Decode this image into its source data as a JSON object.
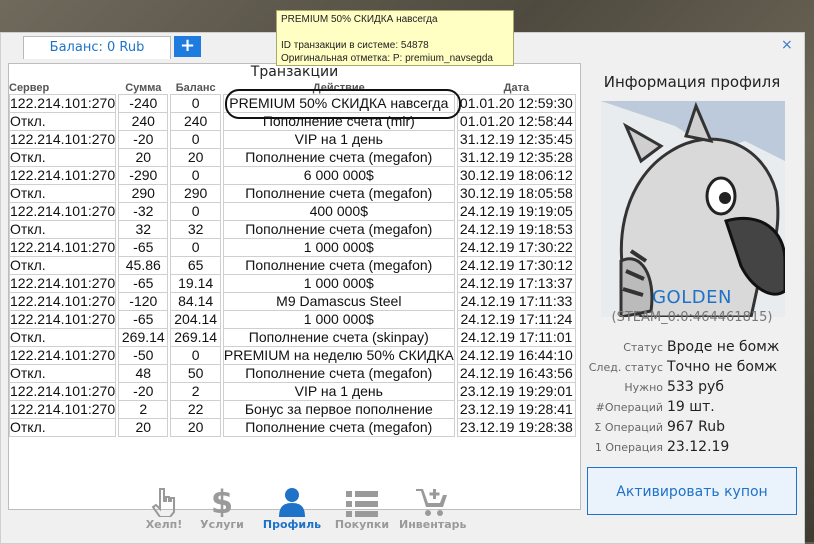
{
  "tabs": {
    "balance_label": "Баланс: 0 Rub",
    "add_label": "+"
  },
  "close_label": "×",
  "tooltip": {
    "line1": "PREMIUM 50% СКИДКА навсегда",
    "line2": "ID транзакции в системе: 54878",
    "line3": "Оригинальная отметка: P: premium_navsegda"
  },
  "transactions": {
    "title": "Транзакции",
    "columns": [
      "Сервер",
      "Сумма",
      "Баланс",
      "Действие",
      "Дата"
    ],
    "rows": [
      [
        "122.214.101:270",
        "-240",
        "0",
        "PREMIUM 50% СКИДКА навсегда",
        "01.01.20 12:59:30"
      ],
      [
        "Откл.",
        "240",
        "240",
        "Пополнение счета (mir)",
        "01.01.20 12:58:44"
      ],
      [
        "122.214.101:270",
        "-20",
        "0",
        "VIP на 1 день",
        "31.12.19 12:35:45"
      ],
      [
        "Откл.",
        "20",
        "20",
        "Пополнение счета (megafon)",
        "31.12.19 12:35:28"
      ],
      [
        "122.214.101:270",
        "-290",
        "0",
        "6 000 000$",
        "30.12.19 18:06:12"
      ],
      [
        "Откл.",
        "290",
        "290",
        "Пополнение счета (megafon)",
        "30.12.19 18:05:58"
      ],
      [
        "122.214.101:270",
        "-32",
        "0",
        "400 000$",
        "24.12.19 19:19:05"
      ],
      [
        "Откл.",
        "32",
        "32",
        "Пополнение счета (megafon)",
        "24.12.19 19:18:53"
      ],
      [
        "122.214.101:270",
        "-65",
        "0",
        "1 000 000$",
        "24.12.19 17:30:22"
      ],
      [
        "Откл.",
        "45.86",
        "65",
        "Пополнение счета (megafon)",
        "24.12.19 17:30:12"
      ],
      [
        "122.214.101:270",
        "-65",
        "19.14",
        "1 000 000$",
        "24.12.19 17:13:37"
      ],
      [
        "122.214.101:270",
        "-120",
        "84.14",
        "M9 Damascus Steel",
        "24.12.19 17:11:33"
      ],
      [
        "122.214.101:270",
        "-65",
        "204.14",
        "1 000 000$",
        "24.12.19 17:11:24"
      ],
      [
        "Откл.",
        "269.14",
        "269.14",
        "Пополнение счета (skinpay)",
        "24.12.19 17:11:01"
      ],
      [
        "122.214.101:270",
        "-50",
        "0",
        "PREMIUM на неделю 50% СКИДКА",
        "24.12.19 16:44:10"
      ],
      [
        "Откл.",
        "48",
        "50",
        "Пополнение счета (megafon)",
        "24.12.19 16:43:56"
      ],
      [
        "122.214.101:270",
        "-20",
        "2",
        "VIP на 1 день",
        "23.12.19 19:29:01"
      ],
      [
        "122.214.101:270",
        "2",
        "22",
        "Бонус за первое пополнение",
        "23.12.19 19:28:41"
      ],
      [
        "Откл.",
        "20",
        "20",
        "Пополнение счета (megafon)",
        "23.12.19 19:28:38"
      ]
    ]
  },
  "nav": {
    "items": [
      {
        "label": "Хелп!",
        "icon": "hand-pointer-icon",
        "active": false
      },
      {
        "label": "Услуги",
        "icon": "dollar-icon",
        "active": false
      },
      {
        "label": "Профиль",
        "icon": "user-icon",
        "active": true
      },
      {
        "label": "Покупки",
        "icon": "list-icon",
        "active": false
      },
      {
        "label": "Инвентарь",
        "icon": "cart-plus-icon",
        "active": false
      }
    ]
  },
  "profile": {
    "title": "Информация профиля",
    "name": "GOLDEN",
    "steam_id": "(STEAM_0:0:464461815)",
    "fields": [
      {
        "key": "Статус",
        "value": "Вроде не бомж"
      },
      {
        "key": "След. статус",
        "value": "Точно не бомж"
      },
      {
        "key": "Нужно",
        "value": "533 руб"
      },
      {
        "key": "#Операций",
        "value": "19 шт."
      },
      {
        "key": "Σ Операций",
        "value": "967 Rub"
      },
      {
        "key": "1 Операция",
        "value": "23.12.19"
      }
    ],
    "coupon_button": "Активировать купон"
  },
  "colors": {
    "accent": "#1e73c8",
    "tooltip_bg": "#ffffc4"
  }
}
